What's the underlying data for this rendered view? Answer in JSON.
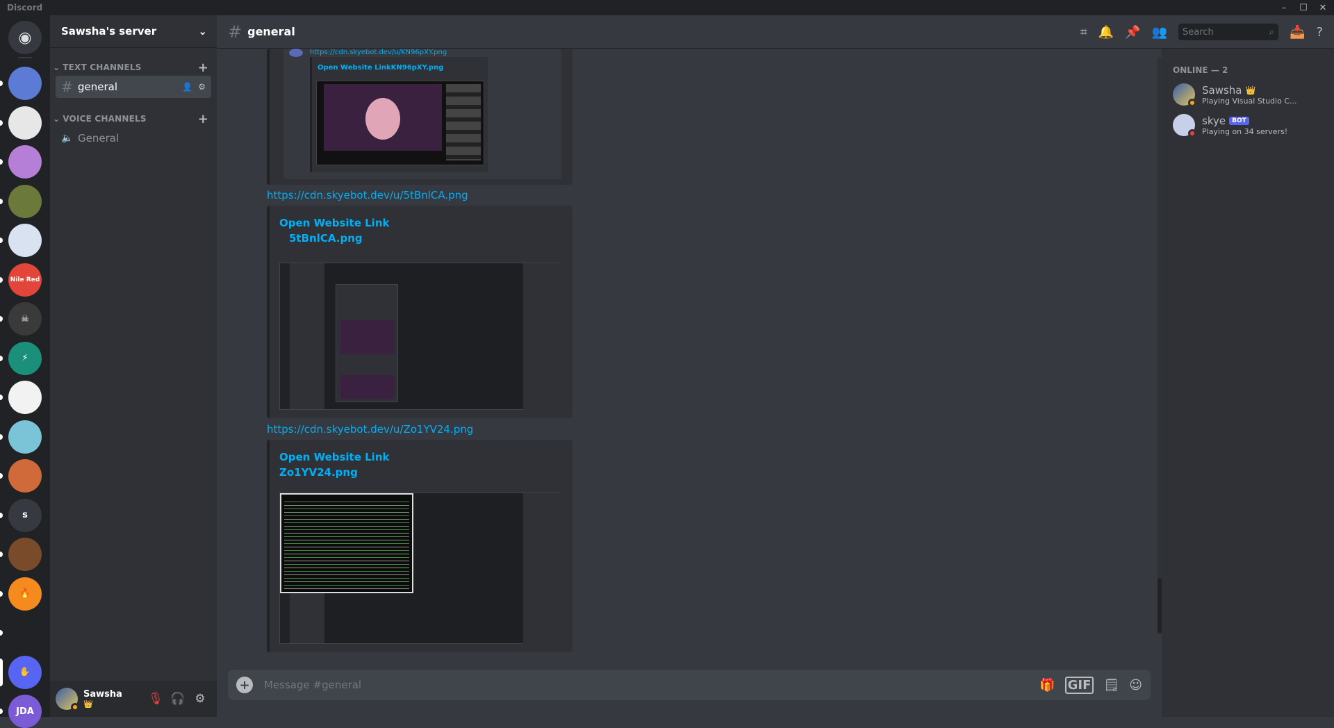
{
  "app": {
    "title": "Discord"
  },
  "window_controls": {
    "minimize": "–",
    "maximize": "☐",
    "close": "✕"
  },
  "guilds": [
    {
      "name": "Discord Home",
      "color": "#36393f",
      "letter": "",
      "icon": "discord-logo-icon"
    },
    {
      "name": "Guild 1",
      "color": "#5b7bd5",
      "letter": ""
    },
    {
      "name": "Guild 2",
      "color": "#e7e7e7",
      "letter": ""
    },
    {
      "name": "Guild 3",
      "color": "#b57fd8",
      "letter": ""
    },
    {
      "name": "Guild 4",
      "color": "#6b7a3a",
      "letter": ""
    },
    {
      "name": "Guild 5",
      "color": "#d9e2f0",
      "letter": ""
    },
    {
      "name": "NileRed",
      "color": "#e2453a",
      "letter": "Nile Red"
    },
    {
      "name": "Guild 7",
      "color": "#3a3a3a",
      "letter": "☠"
    },
    {
      "name": "Guild 8",
      "color": "#1a8f7a",
      "letter": "⚡"
    },
    {
      "name": "Guild 9",
      "color": "#f2f2f2",
      "letter": ""
    },
    {
      "name": "Guild 10",
      "color": "#7bc4d8",
      "letter": ""
    },
    {
      "name": "Guild 11",
      "color": "#d06a3a",
      "letter": ""
    },
    {
      "name": "s",
      "color": "#36393f",
      "letter": "s"
    },
    {
      "name": "Guild 13",
      "color": "#7a4b2b",
      "letter": ""
    },
    {
      "name": "Guild 14",
      "color": "#f58a1f",
      "letter": "🔥"
    },
    {
      "name": "Guild 15",
      "color": "#202225",
      "letter": ""
    },
    {
      "name": "Sawsha's server",
      "color": "#5865f2",
      "letter": "✋"
    },
    {
      "name": "JDA",
      "color": "#7b5cd6",
      "letter": "JDA"
    }
  ],
  "server": {
    "name": "Sawsha's server"
  },
  "categories": {
    "text": "TEXT CHANNELS",
    "voice": "VOICE CHANNELS"
  },
  "channels": {
    "text_selected": "general",
    "voice": "General"
  },
  "header": {
    "channel": "general",
    "search_placeholder": "Search"
  },
  "messages": {
    "link1": "https://cdn.skyebot.dev/u/KN96pXY.png",
    "embed1_title": "Open Website LinkKN96pXY.png",
    "link2": "https://cdn.skyebot.dev/u/5tBnlCA.png",
    "embed2_title_line1": "Open Website Link",
    "embed2_title_line2": "5tBnlCA.png",
    "link3": "https://cdn.skyebot.dev/u/Zo1YV24.png",
    "embed3_title_line1": "Open Website Link",
    "embed3_title_line2": "Zo1YV24.png"
  },
  "composer": {
    "placeholder": "Message #general",
    "gif": "GIF"
  },
  "user": {
    "name": "Sawsha",
    "status_emoji": "👑"
  },
  "members": {
    "heading": "ONLINE — 2",
    "list": [
      {
        "name": "Sawsha",
        "activity": "Playing Visual Studio C...",
        "status_color": "#faa61a",
        "avatar_color": "#3a5fa8",
        "badge": "👑"
      },
      {
        "name": "skye",
        "activity": "Playing on 34 servers!",
        "status_color": "#ed4245",
        "avatar_color": "#c7d0e8",
        "badge": "BOT"
      }
    ]
  }
}
